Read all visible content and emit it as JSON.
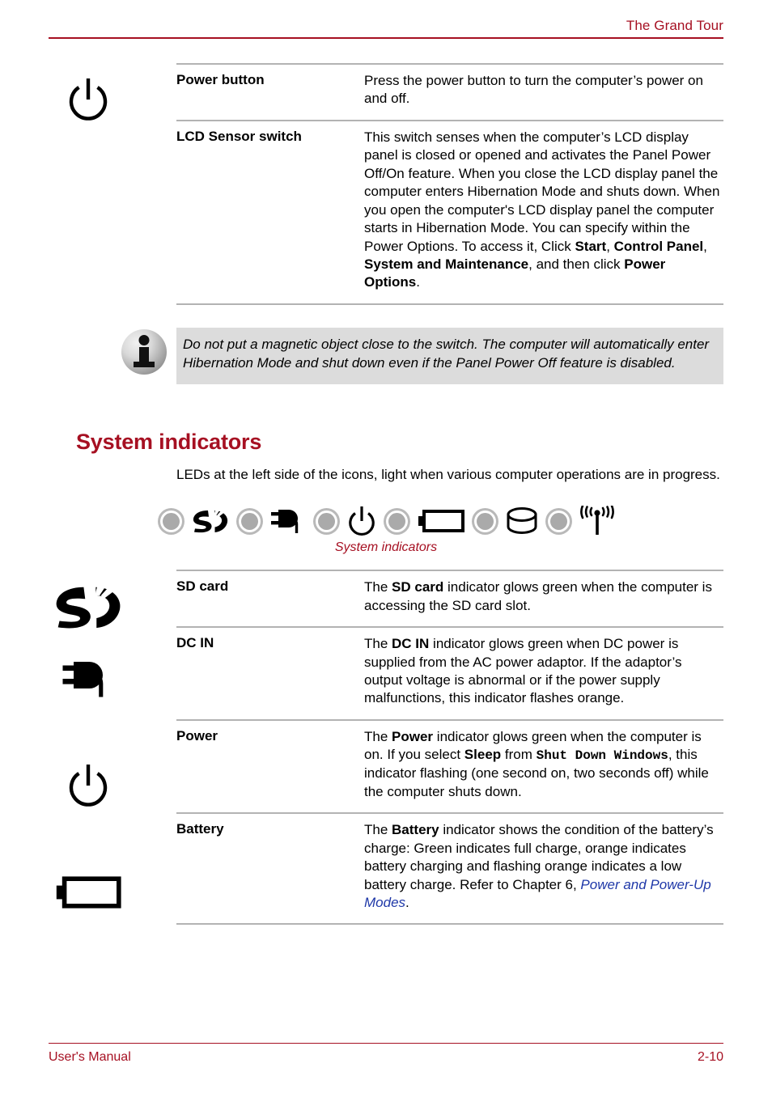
{
  "header": {
    "title": "The Grand Tour"
  },
  "footer": {
    "manual_label": "User's Manual",
    "page_number": "2-10"
  },
  "colors": {
    "accent_red": "#a61022",
    "rule_gray": "#b3b3b3",
    "note_bg": "#dcdcdc",
    "xref_blue": "#1f38a8"
  },
  "top_table": {
    "rows": [
      {
        "icon": "power-button-icon",
        "term": "Power button",
        "desc_html": "Press the power button to turn the computer’s power on and off."
      },
      {
        "icon": "",
        "term": "LCD Sensor switch",
        "desc_html": "This switch senses when the computer’s LCD display panel is closed or opened and activates the Panel Power Off/On feature. When you close the LCD display panel the computer enters Hibernation Mode and shuts down. When you open the computer's LCD display panel the computer starts in Hibernation Mode. You can specify within the Power Options. To access it, Click <b>Start</b>, <b>Control Panel</b>, <b>System and Maintenance</b>, and then click <b>Power Options</b>."
      }
    ]
  },
  "note": {
    "icon": "info-icon",
    "text": "Do not put a magnetic object close to the switch. The computer will automatically enter Hibernation Mode and shut down even if the Panel Power Off feature is disabled."
  },
  "section": {
    "heading": "System indicators",
    "intro": "LEDs at the left side of the icons, light when various computer operations are in progress.",
    "figure_caption": "System indicators",
    "strip": [
      {
        "type": "led",
        "name": "led-indicator-1"
      },
      {
        "type": "icon",
        "name": "sd-card-icon"
      },
      {
        "type": "led",
        "name": "led-indicator-2"
      },
      {
        "type": "icon",
        "name": "dc-in-plug-icon"
      },
      {
        "type": "led",
        "name": "led-indicator-3"
      },
      {
        "type": "icon",
        "name": "power-button-icon"
      },
      {
        "type": "led",
        "name": "led-indicator-4"
      },
      {
        "type": "icon",
        "name": "battery-icon"
      },
      {
        "type": "led",
        "name": "led-indicator-5"
      },
      {
        "type": "icon",
        "name": "hard-disk-drive-icon"
      },
      {
        "type": "led",
        "name": "led-indicator-6"
      },
      {
        "type": "icon",
        "name": "wireless-antenna-icon"
      }
    ]
  },
  "indicator_table": {
    "rows": [
      {
        "icon": "sd-card-icon",
        "term": "SD card",
        "desc_html": "The <b>SD card</b> indicator glows green when the computer is accessing the SD card slot."
      },
      {
        "icon": "dc-in-plug-icon",
        "term": "DC IN",
        "desc_html": "The <b>DC IN</b> indicator glows green when DC power is supplied from the AC power adaptor. If the adaptor’s output voltage is abnormal or if the power supply malfunctions, this indicator flashes orange."
      },
      {
        "icon": "power-button-icon",
        "term": "Power",
        "desc_html": "The <b>Power</b> indicator glows green when the computer is on. If you select <b>Sleep</b> from <span class=\"mono\">Shut Down Windows</span>, this indicator flashing (one second on, two seconds off) while the computer shuts down."
      },
      {
        "icon": "battery-icon",
        "term": "Battery",
        "desc_html": "The <b>Battery</b> indicator shows the condition of the battery’s charge: Green indicates full charge, orange indicates battery charging and flashing orange indicates a low battery charge. Refer to Chapter 6, <span class=\"xref\">Power and Power-Up Modes</span>."
      }
    ]
  }
}
